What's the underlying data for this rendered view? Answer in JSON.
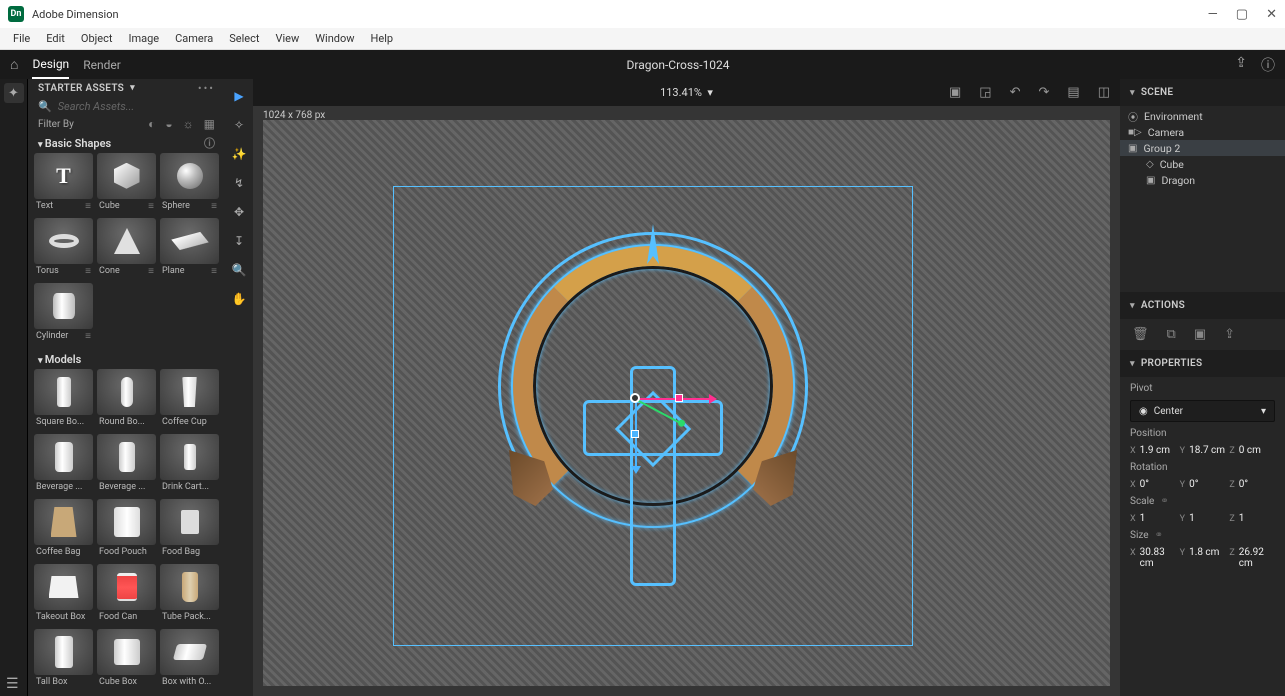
{
  "app": {
    "title": "Adobe Dimension",
    "icon_text": "Dn"
  },
  "window_controls": {
    "min": "—",
    "max": "▢",
    "close": "✕"
  },
  "menus": [
    "File",
    "Edit",
    "Object",
    "Image",
    "Camera",
    "Select",
    "View",
    "Window",
    "Help"
  ],
  "tabs": {
    "design": "Design",
    "render": "Render"
  },
  "document": {
    "title": "Dragon-Cross-1024",
    "dimensions": "1024 x 768 px"
  },
  "zoom": "113.41%",
  "leftpanel": {
    "title": "STARTER ASSETS",
    "search_placeholder": "Search Assets...",
    "filter_label": "Filter By",
    "basic_shapes": "Basic Shapes",
    "models": "Models",
    "shapes": [
      {
        "label": "Text"
      },
      {
        "label": "Cube"
      },
      {
        "label": "Sphere"
      },
      {
        "label": "Torus"
      },
      {
        "label": "Cone"
      },
      {
        "label": "Plane"
      },
      {
        "label": "Cylinder"
      }
    ],
    "model_list": [
      {
        "label": "Square Bo..."
      },
      {
        "label": "Round Bo..."
      },
      {
        "label": "Coffee Cup"
      },
      {
        "label": "Beverage ..."
      },
      {
        "label": "Beverage ..."
      },
      {
        "label": "Drink Cart..."
      },
      {
        "label": "Coffee Bag"
      },
      {
        "label": "Food Pouch"
      },
      {
        "label": "Food Bag"
      },
      {
        "label": "Takeout Box"
      },
      {
        "label": "Food Can"
      },
      {
        "label": "Tube Pack..."
      },
      {
        "label": "Tall Box"
      },
      {
        "label": "Cube Box"
      },
      {
        "label": "Box with O..."
      }
    ]
  },
  "scene": {
    "title": "SCENE",
    "items": [
      {
        "icon": "globe",
        "label": "Environment"
      },
      {
        "icon": "camera",
        "label": "Camera"
      },
      {
        "icon": "folder",
        "label": "Group 2",
        "selected": true
      },
      {
        "icon": "cube",
        "label": "Cube",
        "indent": 1
      },
      {
        "icon": "folder",
        "label": "Dragon",
        "indent": 1
      }
    ]
  },
  "actions": {
    "title": "ACTIONS"
  },
  "properties": {
    "title": "PROPERTIES",
    "pivot_label": "Pivot",
    "pivot_value": "Center",
    "groups": {
      "position": {
        "label": "Position",
        "x": "1.9 cm",
        "y": "18.7 cm",
        "z": "0 cm"
      },
      "rotation": {
        "label": "Rotation",
        "x": "0°",
        "y": "0°",
        "z": "0°"
      },
      "scale": {
        "label": "Scale",
        "x": "1",
        "y": "1",
        "z": "1"
      },
      "size": {
        "label": "Size",
        "x": "30.83 cm",
        "y": "1.8 cm",
        "z": "26.92 cm"
      }
    }
  }
}
